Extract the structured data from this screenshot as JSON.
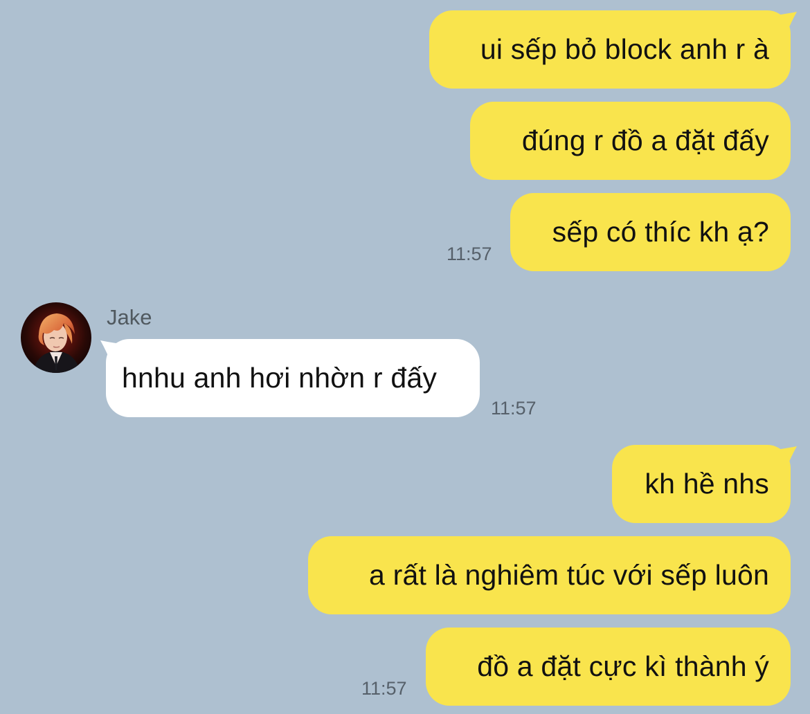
{
  "colors": {
    "background": "#aec0d0",
    "outgoing_bubble": "#f9e44d",
    "incoming_bubble": "#ffffff",
    "timestamp": "#56606a"
  },
  "conversation": {
    "group1": {
      "messages": [
        "ui sếp bỏ block anh r à",
        "đúng r đồ a đặt đấy",
        "sếp có thíc kh ạ?"
      ],
      "time": "11:57"
    },
    "incoming": {
      "sender": "Jake",
      "avatar_icon": "profile-photo-icon",
      "message": "hnhu anh hơi nhờn r đấy",
      "time": "11:57"
    },
    "group2": {
      "messages": [
        "kh hề nhs",
        "a rất là nghiêm túc với sếp luôn",
        "đồ a đặt cực kì thành ý"
      ],
      "time": "11:57"
    }
  }
}
